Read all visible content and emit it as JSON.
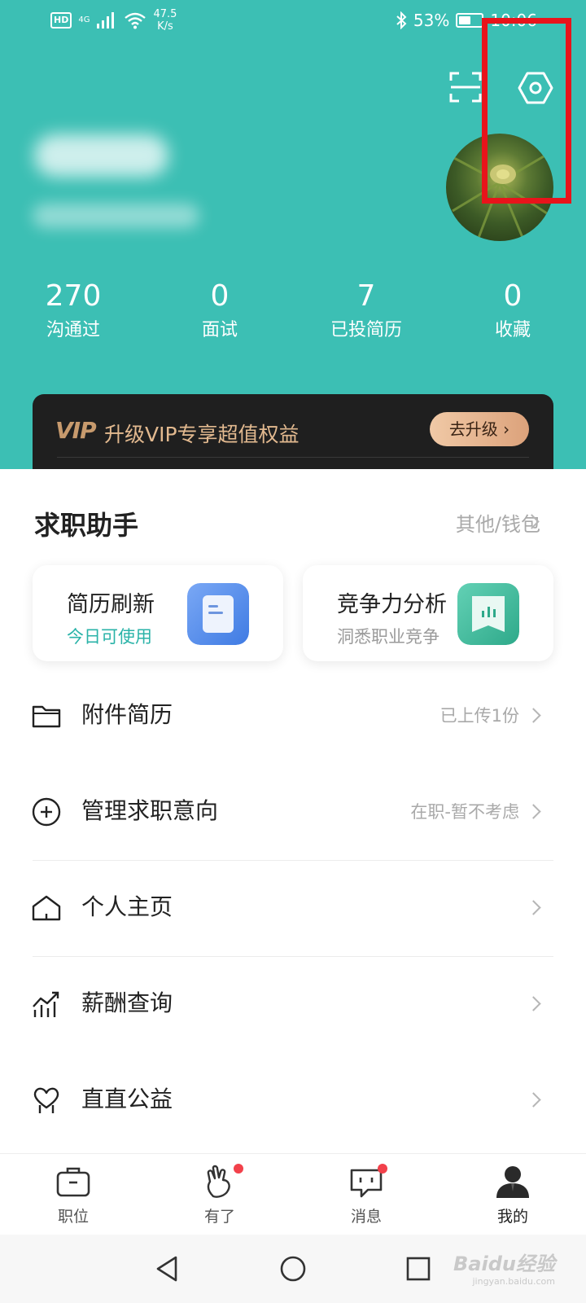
{
  "status_bar": {
    "hd": "HD",
    "network": "4G",
    "speed_value": "47.5",
    "speed_unit": "K/s",
    "battery_percent": "53%",
    "battery_level": 0.53,
    "time": "10:06"
  },
  "header": {
    "scan_icon": "scan-icon",
    "settings_icon": "settings-hex-icon"
  },
  "stats": [
    {
      "value": "270",
      "label": "沟通过"
    },
    {
      "value": "0",
      "label": "面试"
    },
    {
      "value": "7",
      "label": "已投简历"
    },
    {
      "value": "0",
      "label": "收藏"
    }
  ],
  "vip": {
    "logo": "VIP",
    "text": "升级VIP专享超值权益",
    "button": "去升级"
  },
  "assistant": {
    "title": "求职助手",
    "more": "其他/钱包",
    "cards": [
      {
        "title": "简历刷新",
        "subtitle": "今日可使用",
        "subtitle_color": "#2ab3a8",
        "icon": "document-icon"
      },
      {
        "title": "竞争力分析",
        "subtitle": "洞悉职业竞争",
        "subtitle_color": "#9a9a9a",
        "icon": "chart-flag-icon"
      }
    ]
  },
  "menu": [
    {
      "label": "附件简历",
      "value": "已上传1份",
      "icon": "folder-icon"
    },
    {
      "label": "管理求职意向",
      "value": "在职-暂不考虑",
      "icon": "plus-circle-icon"
    },
    {
      "label": "个人主页",
      "value": "",
      "icon": "home-icon"
    },
    {
      "label": "薪酬查询",
      "value": "",
      "icon": "trend-chart-icon"
    },
    {
      "label": "直直公益",
      "value": "",
      "icon": "heart-hands-icon"
    }
  ],
  "tabs": [
    {
      "label": "职位",
      "icon": "briefcase-icon",
      "badge": false
    },
    {
      "label": "有了",
      "icon": "hand-icon",
      "badge": true
    },
    {
      "label": "消息",
      "icon": "chat-icon",
      "badge": true
    },
    {
      "label": "我的",
      "icon": "person-icon",
      "badge": false,
      "active": true
    }
  ],
  "colors": {
    "header_bg": "#3cbfb4",
    "vip_bg": "#1f1f1f",
    "vip_text": "#e2b98f",
    "highlight": "#e8141b",
    "badge": "#f2414b"
  },
  "watermark": {
    "main": "Baidu经验",
    "sub": "jingyan.baidu.com"
  }
}
